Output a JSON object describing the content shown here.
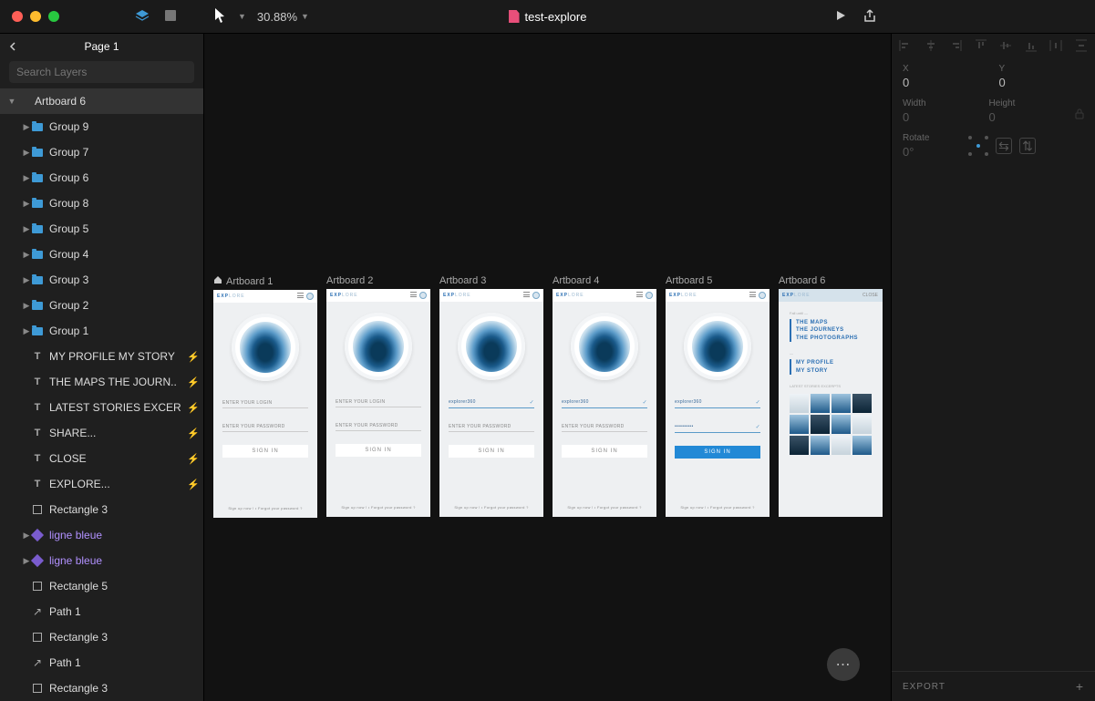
{
  "window": {
    "title": "test-explore"
  },
  "toolbar": {
    "zoom": "30.88%"
  },
  "sidebar": {
    "page_title": "Page 1",
    "search_placeholder": "Search Layers",
    "layers": [
      {
        "kind": "artboard",
        "label": "Artboard 6",
        "depth": 0,
        "open": true,
        "selected": true
      },
      {
        "kind": "folder",
        "label": "Group 9",
        "depth": 1
      },
      {
        "kind": "folder",
        "label": "Group 7",
        "depth": 1
      },
      {
        "kind": "folder",
        "label": "Group 6",
        "depth": 1
      },
      {
        "kind": "folder",
        "label": "Group 8",
        "depth": 1
      },
      {
        "kind": "folder",
        "label": "Group 5",
        "depth": 1
      },
      {
        "kind": "folder",
        "label": "Group 4",
        "depth": 1
      },
      {
        "kind": "folder",
        "label": "Group 3",
        "depth": 1
      },
      {
        "kind": "folder",
        "label": "Group 2",
        "depth": 1
      },
      {
        "kind": "folder",
        "label": "Group 1",
        "depth": 1
      },
      {
        "kind": "text",
        "label": "MY PROFILE MY STORY",
        "depth": 1,
        "flash": true
      },
      {
        "kind": "text",
        "label": "THE MAPS THE JOURN..",
        "depth": 1,
        "flash": true
      },
      {
        "kind": "text",
        "label": "LATEST STORIES EXCER",
        "depth": 1,
        "flash": true
      },
      {
        "kind": "text",
        "label": "SHARE...",
        "depth": 1,
        "flash": true
      },
      {
        "kind": "text",
        "label": "CLOSE",
        "depth": 1,
        "flash": true
      },
      {
        "kind": "text",
        "label": "EXPLORE...",
        "depth": 1,
        "flash": true
      },
      {
        "kind": "rect",
        "label": "Rectangle 3",
        "depth": 1
      },
      {
        "kind": "symbol",
        "label": "ligne bleue",
        "depth": 1,
        "purple": true,
        "disc": true
      },
      {
        "kind": "symbol",
        "label": "ligne bleue",
        "depth": 1,
        "purple": true,
        "disc": true
      },
      {
        "kind": "rect",
        "label": "Rectangle 5",
        "depth": 1
      },
      {
        "kind": "path",
        "label": "Path 1",
        "depth": 1
      },
      {
        "kind": "rect",
        "label": "Rectangle 3",
        "depth": 1
      },
      {
        "kind": "path",
        "label": "Path 1",
        "depth": 1
      },
      {
        "kind": "rect",
        "label": "Rectangle 3",
        "depth": 1
      }
    ]
  },
  "canvas": {
    "artboards": [
      {
        "label": "Artboard 1",
        "home": true,
        "login": "ENTER YOUR LOGIN",
        "login_filled": false,
        "pw": "ENTER YOUR PASSWORD",
        "pw_filled": false,
        "btn": "SIGN IN",
        "btn_filled": false,
        "footer": "Sign up now !  •  Forgot your password ?"
      },
      {
        "label": "Artboard 2",
        "login": "ENTER YOUR LOGIN",
        "login_filled": false,
        "pw": "ENTER YOUR PASSWORD",
        "pw_filled": false,
        "btn": "SIGN IN",
        "btn_filled": false,
        "footer": "Sign up now !  •  Forgot your password ?"
      },
      {
        "label": "Artboard 3",
        "login": "explorer360",
        "login_filled": true,
        "pw": "ENTER YOUR PASSWORD",
        "pw_filled": false,
        "btn": "SIGN IN",
        "btn_filled": false,
        "footer": "Sign up now !  •  Forgot your password ?"
      },
      {
        "label": "Artboard 4",
        "login": "explorer360",
        "login_filled": true,
        "pw": "ENTER YOUR PASSWORD",
        "pw_filled": false,
        "btn": "SIGN IN",
        "btn_filled": false,
        "footer": "Sign up now !  •  Forgot your password ?"
      },
      {
        "label": "Artboard 5",
        "login": "explorer360",
        "login_filled": true,
        "pw": "••••••••••",
        "pw_filled": true,
        "btn": "SIGN IN",
        "btn_filled": true,
        "footer": "Sign up now !  •  Forgot your password ?"
      },
      {
        "label": "Artboard 6",
        "type": "profile"
      }
    ],
    "ab6": {
      "close": "CLOSE",
      "sub1": "Fall until —",
      "lines1": [
        "THE MAPS",
        "THE JOURNEYS",
        "THE PHOTOGRAPHS"
      ],
      "sub2": "—",
      "lines2": [
        "MY PROFILE",
        "MY STORY"
      ],
      "sub3": "LATEST STORIES EXCERPTS"
    },
    "logo": {
      "bold": "EXP",
      "rest": "LORE"
    }
  },
  "inspector": {
    "x_label": "X",
    "x_value": "0",
    "y_label": "Y",
    "y_value": "0",
    "w_label": "Width",
    "w_value": "0",
    "h_label": "Height",
    "h_value": "0",
    "r_label": "Rotate",
    "r_value": "0°",
    "export": "EXPORT"
  }
}
